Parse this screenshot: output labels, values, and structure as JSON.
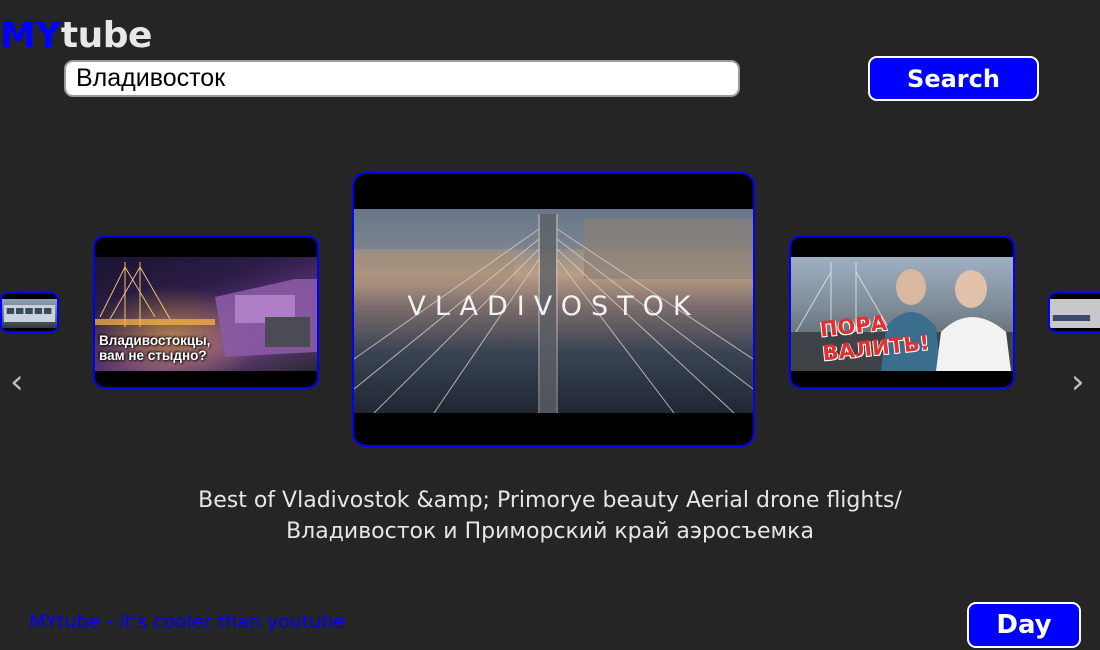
{
  "logo": {
    "part1": "MY",
    "part2": "tube"
  },
  "search": {
    "value": "Владивосток",
    "button_label": "Search"
  },
  "carousel": {
    "prev_icon": "‹",
    "next_icon": "›",
    "left_card": {
      "overlay_line1": "Владивостокцы,",
      "overlay_line2": "вам не стыдно?"
    },
    "center_card": {
      "overlay_title": "VLADIVOSTOK"
    },
    "right_card": {
      "overlay_line1": "ПОРА",
      "overlay_line2": "ВАЛИТЬ!"
    }
  },
  "video": {
    "title_line1": "Best of Vladivostok &amp; Primorye beauty Aerial drone flights/",
    "title_line2": "Владивосток и Приморский край аэросъемка"
  },
  "footer": {
    "tagline": "MYtube - it's cooler than youtube",
    "theme_button_label": "Day"
  },
  "colors": {
    "background": "#252526",
    "accent": "#0000ff",
    "text": "#e6e6e6"
  }
}
